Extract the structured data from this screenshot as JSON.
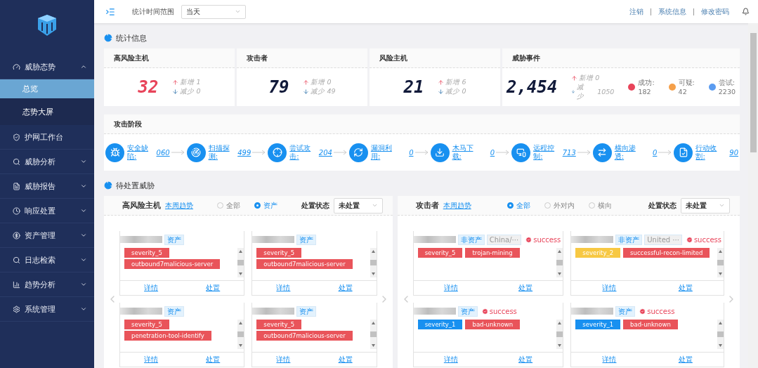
{
  "header": {
    "time_label": "统计时间范围",
    "time_value": "当天",
    "links": [
      "注销",
      "系统信息",
      "修改密码"
    ]
  },
  "sidebar": {
    "items": [
      {
        "label": "威胁态势",
        "kind": "group",
        "expanded": true,
        "children": [
          {
            "label": "总览",
            "selected": true
          },
          {
            "label": "态势大屏",
            "selected": false
          }
        ]
      },
      {
        "label": "护网工作台",
        "kind": "link"
      },
      {
        "label": "威胁分析",
        "kind": "group",
        "expanded": false
      },
      {
        "label": "威胁报告",
        "kind": "group",
        "expanded": false
      },
      {
        "label": "响应处置",
        "kind": "group",
        "expanded": false
      },
      {
        "label": "资产管理",
        "kind": "group",
        "expanded": false
      },
      {
        "label": "日志检索",
        "kind": "group",
        "expanded": false
      },
      {
        "label": "趋势分析",
        "kind": "group",
        "expanded": false
      },
      {
        "label": "系统管理",
        "kind": "group",
        "expanded": false
      }
    ]
  },
  "stats": {
    "title": "统计信息",
    "cards": [
      {
        "title": "高风险主机",
        "value": "32",
        "highlight": true,
        "added": "新增 1",
        "removed": "减少 0"
      },
      {
        "title": "攻击者",
        "value": "79",
        "highlight": false,
        "added": "新增 0",
        "removed": "减少 49"
      },
      {
        "title": "风险主机",
        "value": "21",
        "highlight": false,
        "added": "新增 6",
        "removed": "减少 0"
      },
      {
        "title": "威胁事件",
        "value": "2,454",
        "highlight": false,
        "added": "新增 0",
        "removed": "减少",
        "removed_value": "1050",
        "breakdown": [
          {
            "label": "成功:",
            "value": "182",
            "color": "#e8445a"
          },
          {
            "label": "可疑:",
            "value": "42",
            "color": "#f5a04a"
          },
          {
            "label": "尝试:",
            "value": "2230",
            "color": "#5b9cf0"
          }
        ]
      }
    ]
  },
  "stages": {
    "title": "攻击阶段",
    "items": [
      {
        "label": "安全缺陷:",
        "count": "060"
      },
      {
        "label": "扫描探测:",
        "count": "499"
      },
      {
        "label": "尝试攻击:",
        "count": "204"
      },
      {
        "label": "漏洞利用:",
        "count": "0"
      },
      {
        "label": "木马下载:",
        "count": "0"
      },
      {
        "label": "远程控制:",
        "count": "713"
      },
      {
        "label": "横向渗透:",
        "count": "0"
      },
      {
        "label": "行动收割:",
        "count": "90"
      }
    ]
  },
  "pending": {
    "title": "待处置威胁",
    "panels": [
      {
        "title": "高风险主机",
        "trend": "本周趋势",
        "radios": [
          {
            "label": "全部",
            "selected": false
          },
          {
            "label": "资产",
            "selected": true
          }
        ],
        "status_label": "处置状态",
        "status_value": "未处置",
        "cards": [
          {
            "tags": [
              {
                "label": "资产",
                "kind": "asset"
              }
            ],
            "labels": [
              {
                "text": "severity_5",
                "color": "#e9545a"
              },
              {
                "text": "outbound7malicious-server",
                "color": "#e9545a"
              }
            ],
            "actions": [
              "详情",
              "处置"
            ]
          },
          {
            "tags": [
              {
                "label": "资产",
                "kind": "asset"
              }
            ],
            "labels": [
              {
                "text": "severity_5",
                "color": "#e9545a"
              },
              {
                "text": "outbound7malicious-server",
                "color": "#e9545a"
              }
            ],
            "actions": [
              "详情",
              "处置"
            ]
          },
          {
            "tags": [
              {
                "label": "资产",
                "kind": "asset"
              }
            ],
            "labels": [
              {
                "text": "severity_5",
                "color": "#e9545a"
              },
              {
                "text": "penetration-tool-identify",
                "color": "#e9545a"
              }
            ],
            "actions": [
              "详情",
              "处置"
            ]
          },
          {
            "tags": [
              {
                "label": "资产",
                "kind": "asset"
              }
            ],
            "labels": [
              {
                "text": "severity_5",
                "color": "#e9545a"
              },
              {
                "text": "outbound7malicious-server",
                "color": "#e9545a"
              }
            ],
            "actions": [
              "详情",
              "处置"
            ]
          }
        ]
      },
      {
        "title": "攻击者",
        "trend": "本周趋势",
        "radios": [
          {
            "label": "全部",
            "selected": true
          },
          {
            "label": "外对内",
            "selected": false
          },
          {
            "label": "横向",
            "selected": false
          }
        ],
        "status_label": "处置状态",
        "status_value": "未处置",
        "cards": [
          {
            "tags": [
              {
                "label": "非资产",
                "kind": "asset"
              },
              {
                "label": "China/···",
                "kind": "location"
              },
              {
                "label": "success",
                "kind": "result"
              }
            ],
            "labels": [
              {
                "text": "severity_5",
                "color": "#e9545a"
              },
              {
                "text": "trojan-mining",
                "color": "#e9545a"
              }
            ],
            "actions": [
              "详情",
              "处置"
            ]
          },
          {
            "tags": [
              {
                "label": "非资产",
                "kind": "asset"
              },
              {
                "label": "United ···",
                "kind": "location"
              },
              {
                "label": "success",
                "kind": "result"
              }
            ],
            "labels": [
              {
                "text": "severity_2",
                "color": "#f7c843"
              },
              {
                "text": "successful-recon-limited",
                "color": "#e9545a"
              }
            ],
            "actions": [
              "详情",
              "处置"
            ]
          },
          {
            "tags": [
              {
                "label": "资产",
                "kind": "asset"
              },
              {
                "label": "success",
                "kind": "result"
              }
            ],
            "labels": [
              {
                "text": "severity_1",
                "color": "#1890f0"
              },
              {
                "text": "bad-unknown",
                "color": "#e9545a"
              }
            ],
            "actions": [
              "详情",
              "处置"
            ]
          },
          {
            "tags": [
              {
                "label": "资产",
                "kind": "asset"
              },
              {
                "label": "success",
                "kind": "result"
              }
            ],
            "labels": [
              {
                "text": "severity_1",
                "color": "#1890f0"
              },
              {
                "text": "bad-unknown",
                "color": "#e9545a"
              }
            ],
            "actions": [
              "详情",
              "处置"
            ]
          }
        ]
      }
    ]
  }
}
